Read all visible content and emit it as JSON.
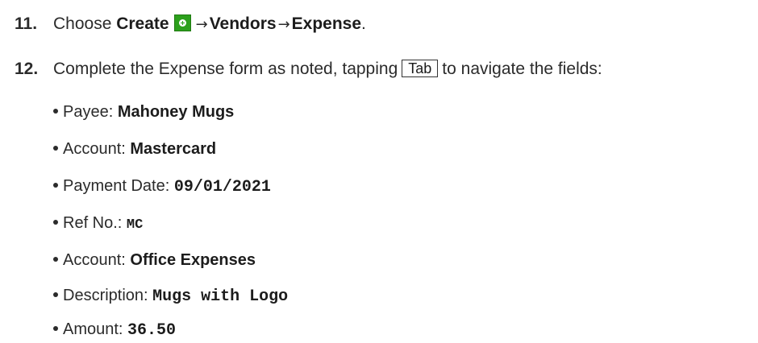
{
  "step11": {
    "number": "11.",
    "prefix": "Choose ",
    "create": "Create",
    "arrow1": "→",
    "vendors": "Vendors",
    "arrow2": "→",
    "expense": "Expense",
    "period": ".",
    "icon": "create-plus-icon"
  },
  "step12": {
    "number": "12.",
    "text_before": "Complete the Expense form as noted, tapping",
    "key": "Tab",
    "text_after": "to navigate the fields:"
  },
  "fields": [
    {
      "label": "Payee: ",
      "value": "Mahoney Mugs",
      "style": "bold"
    },
    {
      "label": "Account: ",
      "value": "Mastercard",
      "style": "bold"
    },
    {
      "label": "Payment Date: ",
      "value": "09/01/2021",
      "style": "mono"
    },
    {
      "label": "Ref No.: ",
      "value": "MC",
      "style": "mono"
    },
    {
      "label": "Account: ",
      "value": "Office Expenses",
      "style": "bold"
    },
    {
      "label": "Description: ",
      "value": "Mugs with Logo",
      "style": "mono"
    },
    {
      "label": "Amount: ",
      "value": "36.50",
      "style": "mono"
    }
  ]
}
